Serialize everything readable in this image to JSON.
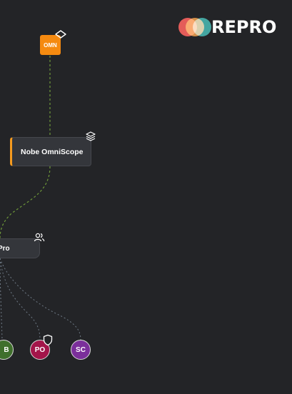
{
  "brand": {
    "name": "REPRO",
    "colors": [
      "#e0413b",
      "#e38a2b",
      "#2aa7a0"
    ]
  },
  "diagram": {
    "root": {
      "label": "OMN",
      "color": "#f58a10",
      "icon": "diamond-icon"
    },
    "nodes": [
      {
        "id": "omniscope",
        "label": "Nobe OmniScope",
        "icon": "layers-icon",
        "accent": "#f59a1f"
      },
      {
        "id": "pro",
        "label": "Pro",
        "icon": "users-icon"
      }
    ],
    "members": [
      {
        "id": "b",
        "label": "B",
        "color": "#3f6f2c"
      },
      {
        "id": "po",
        "label": "PO",
        "color": "#a3154a",
        "icon": "shield-icon"
      },
      {
        "id": "sc",
        "label": "SC",
        "color": "#7b2f9b"
      }
    ],
    "edge_colors": {
      "primary": "#6f9a3a",
      "secondary": "#6f7a86"
    }
  }
}
